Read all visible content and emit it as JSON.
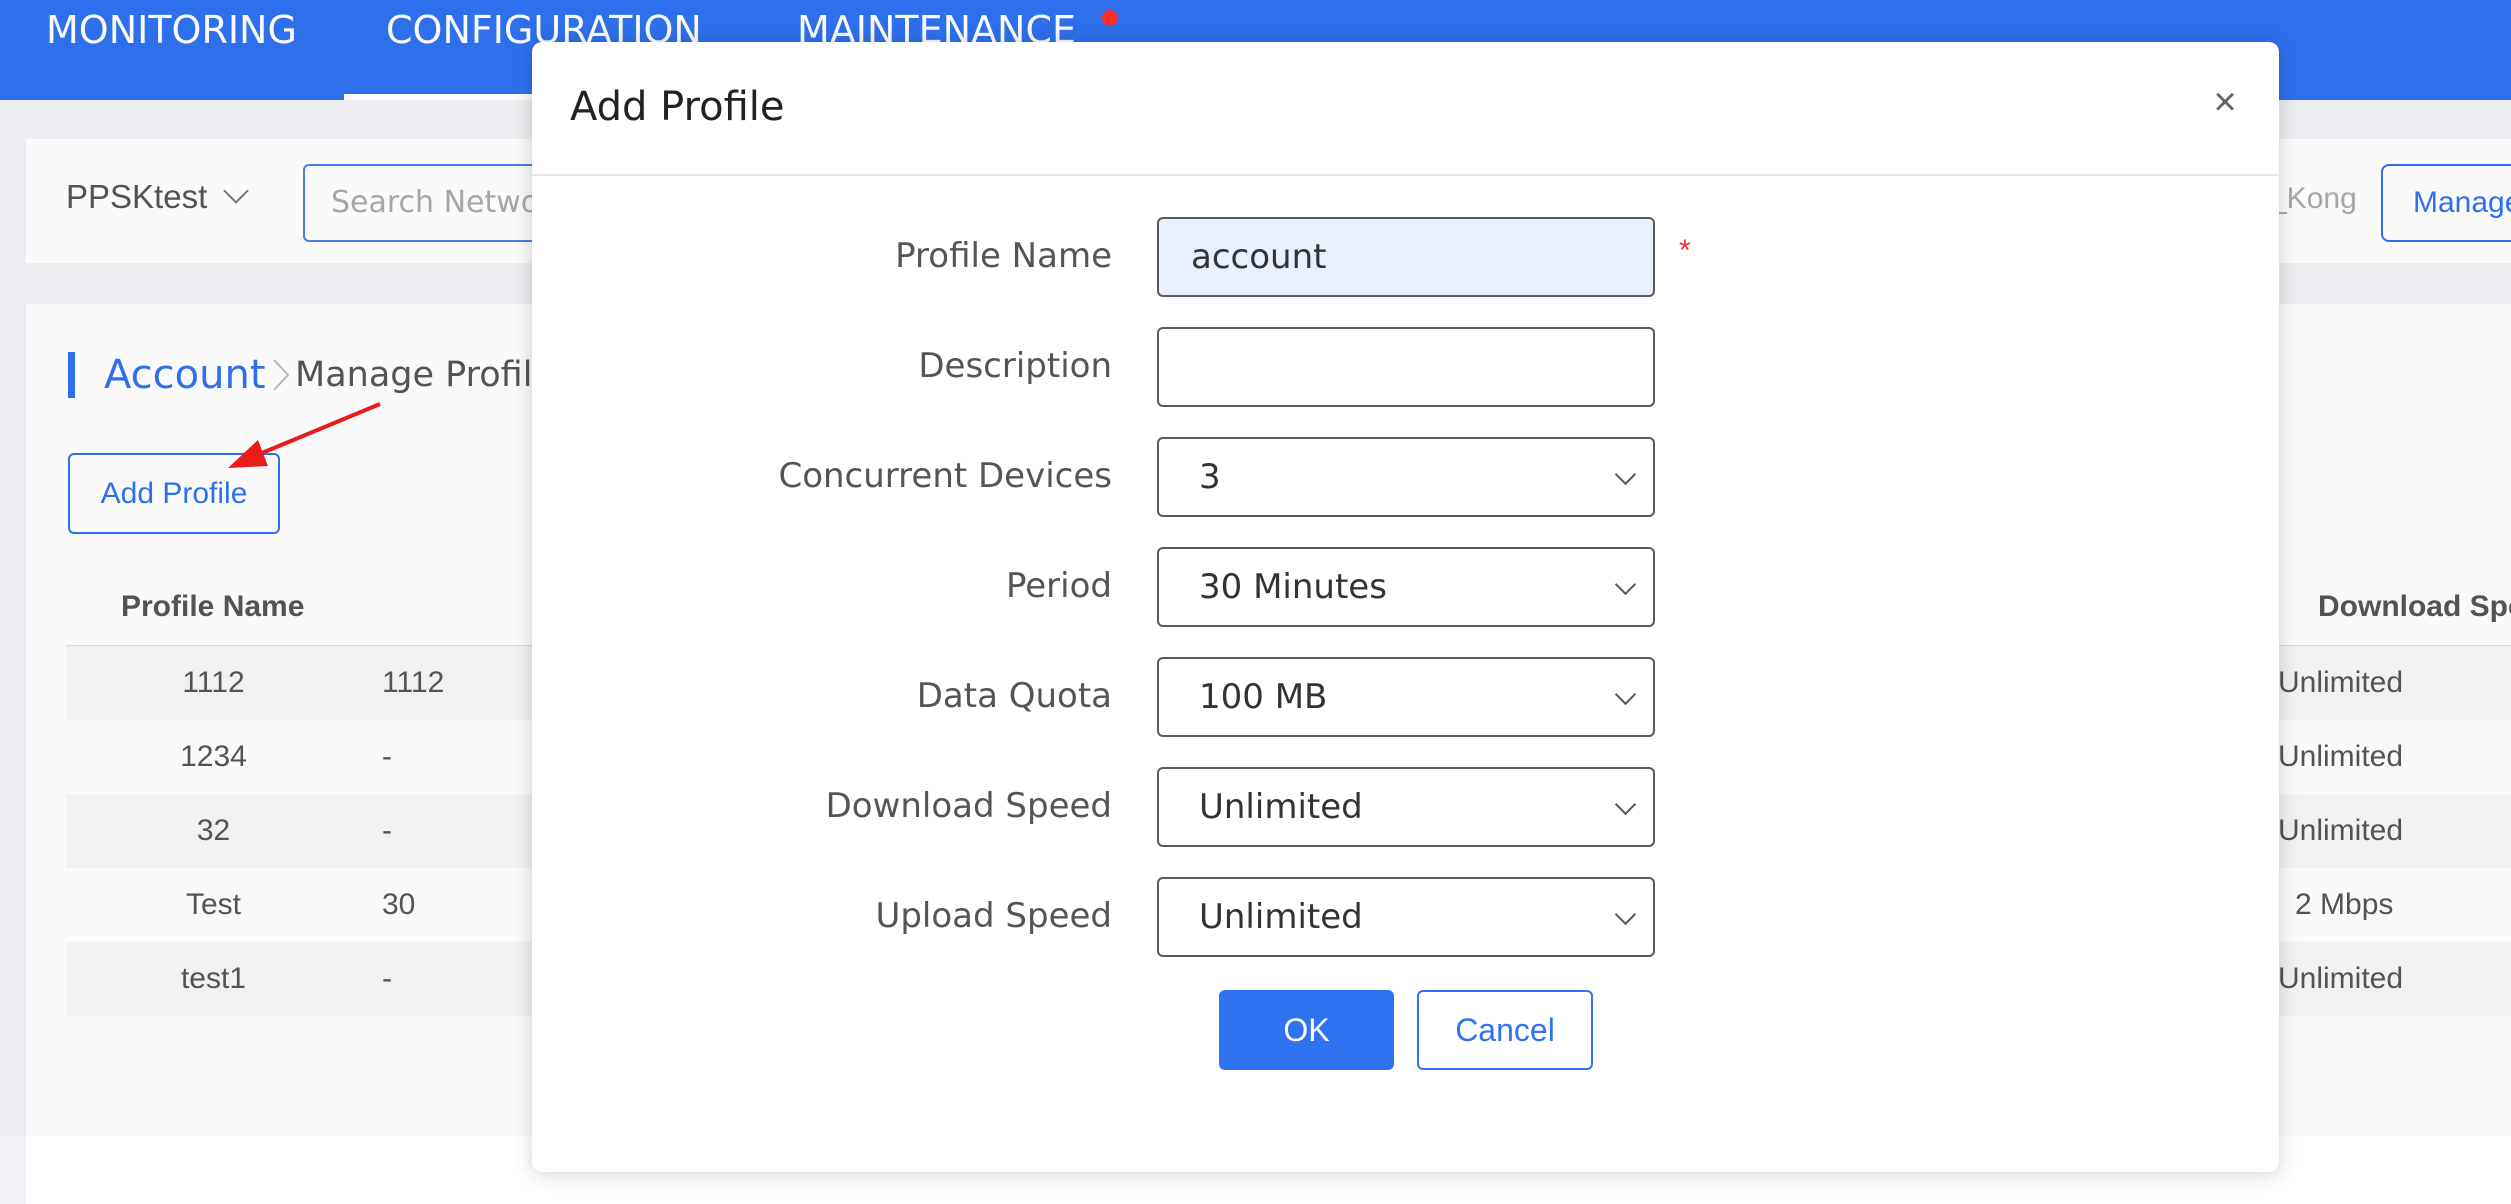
{
  "nav": {
    "items": [
      "MONITORING",
      "CONFIGURATION",
      "MAINTENANCE"
    ],
    "colors": {
      "bar": "#2f73f0",
      "dot": "#ff2d2d"
    }
  },
  "filter": {
    "network": "PPSKtest",
    "search_placeholder": "Search Network",
    "user_fragment": "_Kong",
    "manage_label": "Manage"
  },
  "breadcrumb": {
    "parent": "Account",
    "current": "Manage Profile"
  },
  "page": {
    "add_profile_label": "Add Profile"
  },
  "table": {
    "headers": {
      "profile_name": "Profile Name",
      "download": "Download Spe"
    },
    "rows": [
      {
        "name": "1112",
        "col2": "1112",
        "download": "Unlimited"
      },
      {
        "name": "1234",
        "col2": "-",
        "download": "Unlimited"
      },
      {
        "name": "32",
        "col2": "-",
        "download": "Unlimited"
      },
      {
        "name": "Test",
        "col2": "30",
        "download": "2 Mbps"
      },
      {
        "name": "test1",
        "col2": "-",
        "download": "Unlimited"
      }
    ]
  },
  "modal": {
    "title": "Add Profile",
    "close_icon": "×",
    "fields": {
      "profile_name": {
        "label": "Profile Name",
        "value": "account",
        "required_mark": "*"
      },
      "description": {
        "label": "Description",
        "value": ""
      },
      "concurrent_devices": {
        "label": "Concurrent Devices",
        "value": "3"
      },
      "period": {
        "label": "Period",
        "value": "30 Minutes"
      },
      "data_quota": {
        "label": "Data Quota",
        "value": "100 MB"
      },
      "download_speed": {
        "label": "Download Speed",
        "value": "Unlimited"
      },
      "upload_speed": {
        "label": "Upload Speed",
        "value": "Unlimited"
      }
    },
    "ok_label": "OK",
    "cancel_label": "Cancel"
  }
}
